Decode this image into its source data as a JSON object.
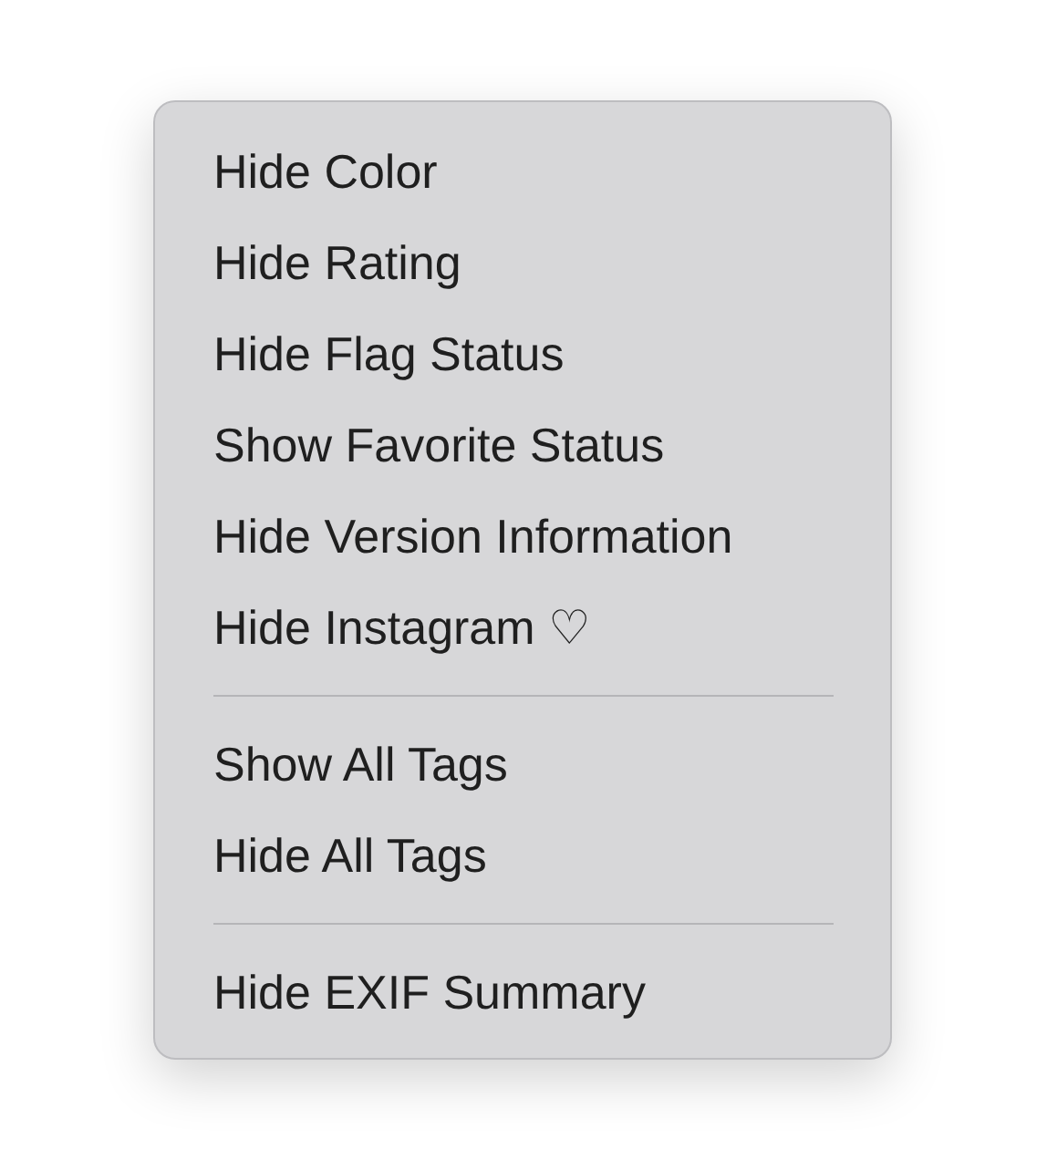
{
  "menu": {
    "sections": [
      {
        "items": [
          {
            "label": "Hide Color"
          },
          {
            "label": "Hide Rating"
          },
          {
            "label": "Hide Flag Status"
          },
          {
            "label": "Show Favorite Status"
          },
          {
            "label": "Hide Version Information"
          },
          {
            "label": "Hide Instagram ♡"
          }
        ]
      },
      {
        "items": [
          {
            "label": "Show All Tags"
          },
          {
            "label": "Hide All Tags"
          }
        ]
      },
      {
        "items": [
          {
            "label": "Hide EXIF Summary"
          }
        ]
      }
    ]
  }
}
